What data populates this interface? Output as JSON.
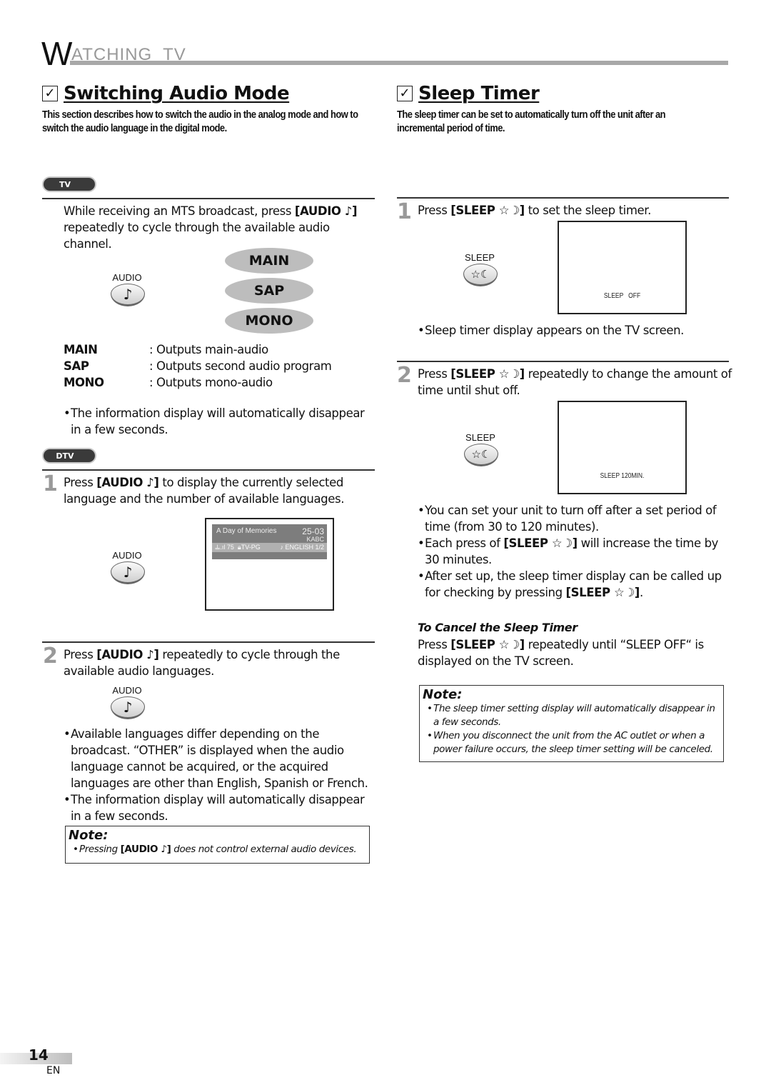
{
  "header": {
    "title_initial": "W",
    "title_rest": "ATCHING  TV"
  },
  "left": {
    "title": "Switching Audio Mode",
    "description": "This section describes how to switch the audio in the analog mode and how to switch the audio language in the digital mode.",
    "tv_section": {
      "mode_label": "TV",
      "instruction_pre": "While receiving an MTS broadcast, press ",
      "instruction_key": "[AUDIO ♪]",
      "instruction_post": " repeatedly to cycle through the available audio channel.",
      "button_label": "AUDIO",
      "button_icon": "♪",
      "modes": [
        "MAIN",
        "SAP",
        "MONO"
      ],
      "definitions": [
        {
          "key": "MAIN",
          "value": ": Outputs main-audio"
        },
        {
          "key": "SAP",
          "value": ": Outputs second audio program"
        },
        {
          "key": "MONO",
          "value": ": Outputs mono-audio"
        }
      ],
      "bullet": "The information display will automatically disappear in a few seconds."
    },
    "dtv_section": {
      "mode_label": "DTV",
      "step1": {
        "number": "1",
        "pre": "Press ",
        "key": "[AUDIO ♪]",
        "post": " to display the currently selected language and the number of available languages.",
        "button_label": "AUDIO",
        "button_icon": "♪",
        "banner": {
          "program": "A Day of Memories",
          "channel": "25-03",
          "station": "KABC",
          "signal": "75",
          "rating": "TV-PG",
          "language": "ENGLISH",
          "language_count": "1/2"
        }
      },
      "step2": {
        "number": "2",
        "pre": "Press ",
        "key": "[AUDIO ♪]",
        "post": " repeatedly to cycle through the available audio languages.",
        "button_label": "AUDIO",
        "button_icon": "♪",
        "bullets": [
          "Available languages differ depending on the broadcast. “OTHER” is displayed when the audio language cannot be acquired, or the acquired languages are other than English, Spanish or French.",
          "The information display will automatically disappear in a few seconds."
        ]
      },
      "note": {
        "title": "Note:",
        "pre": "Pressing ",
        "key": "[AUDIO ♪]",
        "post": " does not control external audio devices."
      }
    }
  },
  "right": {
    "title": "Sleep Timer",
    "description": "The sleep timer can be set to automatically turn off the unit after an incremental period of time.",
    "step1": {
      "number": "1",
      "pre": "Press ",
      "key": "[SLEEP ☆☽]",
      "post": " to set the sleep timer.",
      "button_label": "SLEEP",
      "button_icon": "☆☾",
      "screen_text": "SLEEP   OFF",
      "bullet": "Sleep timer display appears on the TV screen."
    },
    "step2": {
      "number": "2",
      "pre": "Press ",
      "key": "[SLEEP ☆☽]",
      "post": " repeatedly to change the amount of time until shut off.",
      "button_label": "SLEEP",
      "button_icon": "☆☾",
      "screen_text": "SLEEP 120MIN.",
      "bullets": [
        {
          "pre": "You can set your unit to turn off after a set period of time (from 30 to 120 minutes).",
          "key": "",
          "post": ""
        },
        {
          "pre": "Each press of ",
          "key": "[SLEEP ☆☽]",
          "post": " will increase the time by 30 minutes."
        },
        {
          "pre": "After set up, the sleep timer display can be called up for checking by pressing ",
          "key": "[SLEEP ☆☽]",
          "post": "."
        }
      ]
    },
    "cancel": {
      "heading": "To Cancel the Sleep Timer",
      "pre": "Press ",
      "key": "[SLEEP ☆☽]",
      "post": " repeatedly until “SLEEP OFF“ is displayed on the TV screen."
    },
    "note": {
      "title": "Note:",
      "items": [
        "The sleep timer setting display will automatically disappear in a few seconds.",
        "When you disconnect the unit from the AC outlet or when a power failure occurs, the sleep timer setting will be canceled."
      ]
    }
  },
  "footer": {
    "page_number": "14",
    "language": "EN"
  }
}
